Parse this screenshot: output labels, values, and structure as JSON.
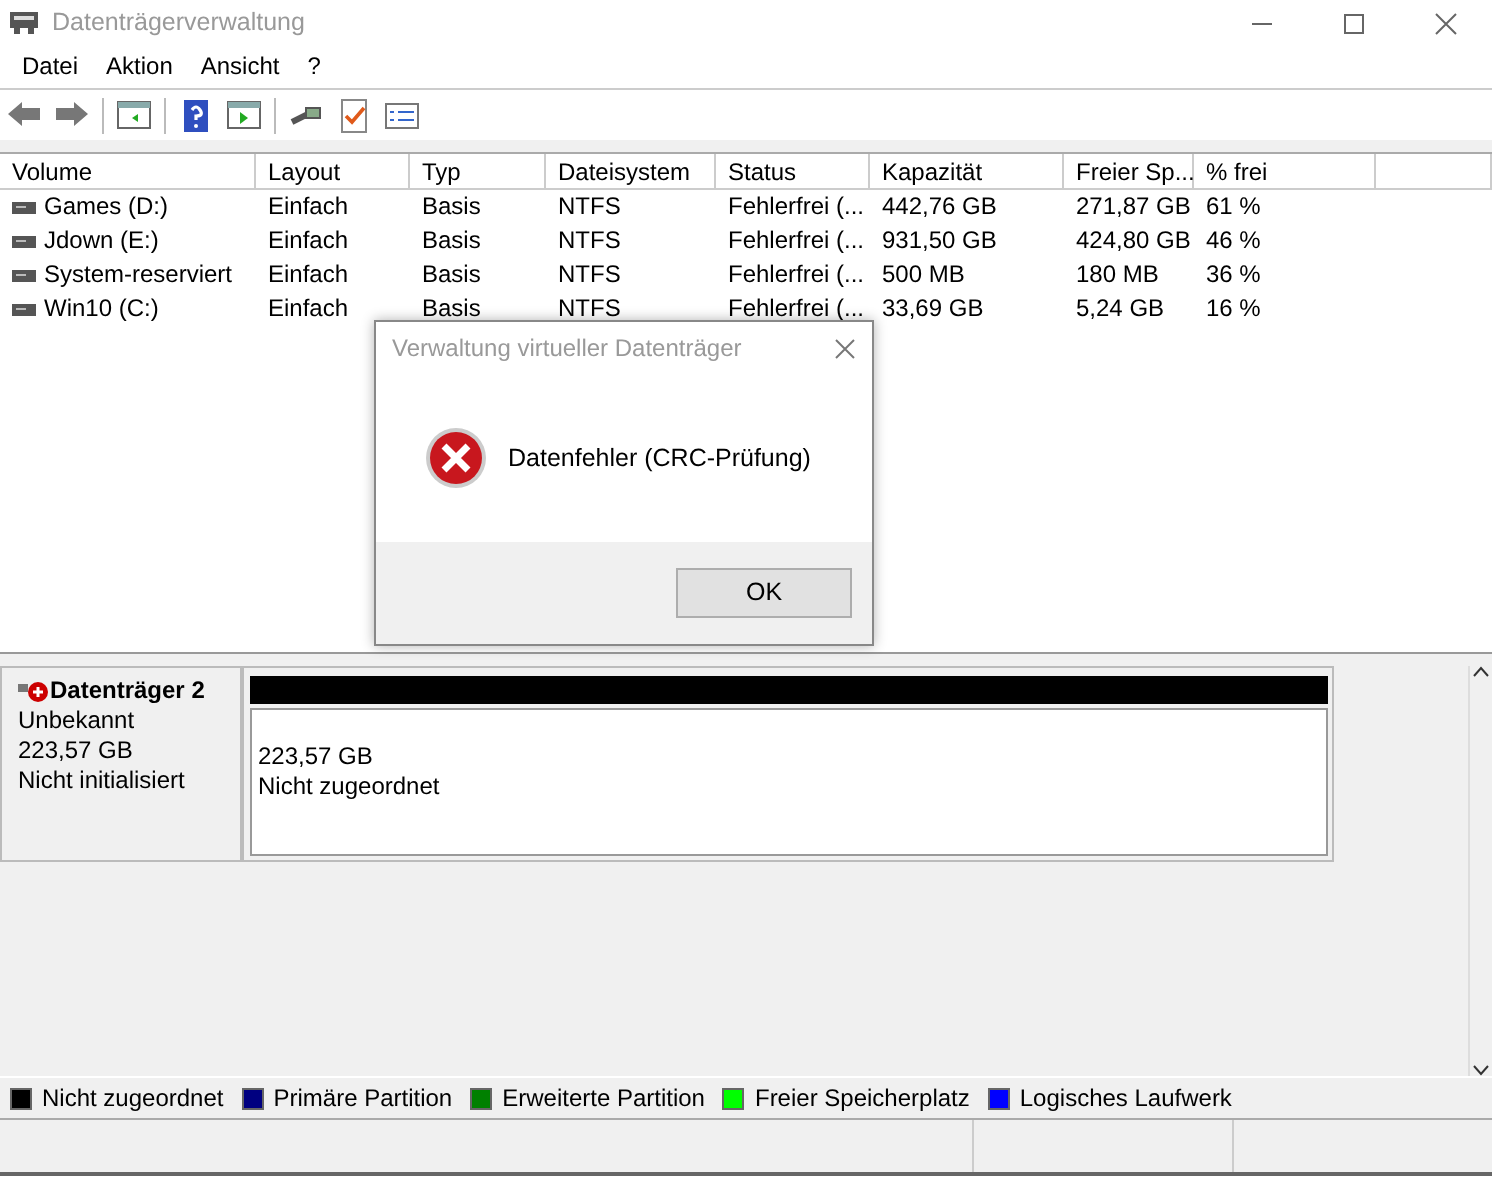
{
  "window": {
    "title": "Datenträgerverwaltung"
  },
  "menu": [
    "Datei",
    "Aktion",
    "Ansicht",
    "?"
  ],
  "table": {
    "columns": [
      "Volume",
      "Layout",
      "Typ",
      "Dateisystem",
      "Status",
      "Kapazität",
      "Freier Sp...",
      "% frei"
    ],
    "rows": [
      [
        "Games (D:)",
        "Einfach",
        "Basis",
        "NTFS",
        "Fehlerfrei (...",
        "442,76 GB",
        "271,87 GB",
        "61 %"
      ],
      [
        "Jdown (E:)",
        "Einfach",
        "Basis",
        "NTFS",
        "Fehlerfrei (...",
        "931,50 GB",
        "424,80 GB",
        "46 %"
      ],
      [
        "System-reserviert",
        "Einfach",
        "Basis",
        "NTFS",
        "Fehlerfrei (...",
        "500 MB",
        "180 MB",
        "36 %"
      ],
      [
        "Win10 (C:)",
        "Einfach",
        "Basis",
        "NTFS",
        "Fehlerfrei (...",
        "33,69 GB",
        "5,24 GB",
        "16 %"
      ]
    ]
  },
  "disk": {
    "name": "Datenträger 2",
    "type": "Unbekannt",
    "size": "223,57 GB",
    "state": "Nicht initialisiert",
    "partition": {
      "size": "223,57 GB",
      "label": "Nicht zugeordnet",
      "color": "#000000"
    }
  },
  "legend": [
    {
      "label": "Nicht zugeordnet",
      "color": "#000000"
    },
    {
      "label": "Primäre Partition",
      "color": "#000080"
    },
    {
      "label": "Erweiterte Partition",
      "color": "#008000"
    },
    {
      "label": "Freier Speicherplatz",
      "color": "#00ff00"
    },
    {
      "label": "Logisches Laufwerk",
      "color": "#0000ff"
    }
  ],
  "dialog": {
    "title": "Verwaltung virtueller Datenträger",
    "message": "Datenfehler (CRC-Prüfung)",
    "button": "OK"
  }
}
